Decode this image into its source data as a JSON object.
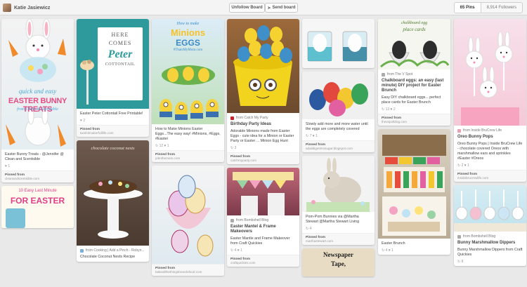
{
  "header": {
    "owner_name": "Katie Jasiewicz",
    "unfollow_label": "Unfollow Board",
    "send_label": "Send board",
    "pins_label": "65 Pins",
    "followers_label": "8,914 Followers"
  },
  "pins": {
    "p1": {
      "img_text_a": "quick and easy",
      "img_text_b": "EASTER BUNNY TREATS",
      "img_text_c": "from Clean & Scentsible"
    },
    "p2": {
      "desc": "Easter Bunny Treats - @Jennifer @ Clean and Scentsible",
      "meta": "♥ 1",
      "pinned": "Pinned from",
      "url": "cleanandscentsible.com"
    },
    "p3": {
      "img_text_a": "10 Easy Last Minute",
      "img_text_b": "FOR EASTER"
    },
    "p4": {
      "img_text_a": "HERE",
      "img_text_b": "COMES",
      "img_text_c": "Peter",
      "img_text_d": "COTTONTAIL"
    },
    "p5": {
      "desc": "Easter Peter Cottontail Free Printable!",
      "meta": "♥ 2",
      "pinned": "Pinned from",
      "url": "twinfolmakerfulllife.com"
    },
    "p6": {
      "img_text_a": "chocolate coconut nests"
    },
    "p7": {
      "source": "from Cooking | Add a Pinch - Robyn...",
      "desc": "Chocolate Coconut Nests Recipe",
      "meta": ""
    },
    "p8": {
      "img_text_a": "How to make",
      "img_text_b": "Minions",
      "img_text_c": "EGGS",
      "img_text_d": "#ThatsMyMom.com"
    },
    "p9": {
      "desc": "How to Make Minions Easter Eggs...The easy way! #Minions, #Eggs, #Easter",
      "meta": "↻ 12   ♥ 1",
      "pinned": "Pinned from",
      "url": "jobnthemom.com"
    },
    "p10": {
      "pinned": "Pinned from",
      "url": "bakeallthethingsbrandofood.com"
    },
    "p11": {
      "source": "from Catch My Party",
      "title": "Birthday Party Ideas",
      "desc": "Adorable Minions made from Easter Eggs - cute idea for a Minion or Easter Party or Easter ... Minion Egg Hunt",
      "meta": "↻ 3",
      "pinned": "Pinned from",
      "url": "catchmyparty.com"
    },
    "p12": {
      "source": "from Bombshell Blog",
      "title": "Easter Mantel & Frame Makeovers",
      "desc": "Easter Mantle and Frame Makeover from Craft Quickies",
      "meta": "↻ 4   ♥ 1",
      "pinned": "Pinned from",
      "url": "craftquickies.com"
    },
    "p13": {
      "desc": "Slowly add more and more water until the eggs are completely covered",
      "meta": "↻ 7   ♥ 1",
      "pinned": "Pinned from",
      "url": "adaildigestnosugar.blogspot.com"
    },
    "p14": {
      "desc": "Pom-Pom Bunnies via @Martha Stewart @Martha Stewart Living",
      "meta": "↻ 4",
      "pinned": "Pinned from",
      "url": "marthastewart.com"
    },
    "p15": {
      "img_text_a": "Newspaper",
      "img_text_b": "Tape,"
    },
    "p16": {
      "img_text_a": "chalkboard egg",
      "img_text_b": "place cards",
      "source": "from The V Spot",
      "title": "Chalkboard eggs: an easy (last minute) DIY project for Easter Brunch",
      "desc": "Easy DIY chalkboard eggs... perfect place cards for Easter Brunch",
      "meta": "↻ 13   ♥ 2",
      "pinned": "Pinned from",
      "url": "thevspotblog.com"
    },
    "p17": {
      "desc": "Easter Brunch",
      "meta": "↻ 4   ♥ 1"
    },
    "p18": {
      "source": "from Inside BruCrew Life",
      "title": "Oreo Bunny Pops",
      "desc": "Oreo Bunny Pops | Inside BruCrew Life - chocolate covered Oreos with marshmallow ears and sprinkles #Easter #Oreos",
      "meta": "↻ 2   ♥ 1",
      "pinned": "Pinned from",
      "url": "insidebrucrewlife.com"
    },
    "p19": {
      "source": "from Bombshell Blog",
      "title": "Bunny Marshmallow Dippers",
      "desc": "Bunny Marshmallow Dippers from Craft Quickies",
      "meta": "↻ 8"
    }
  },
  "colors": {
    "pinterest_red": "#cb2027",
    "background": "#e9e9e9"
  }
}
